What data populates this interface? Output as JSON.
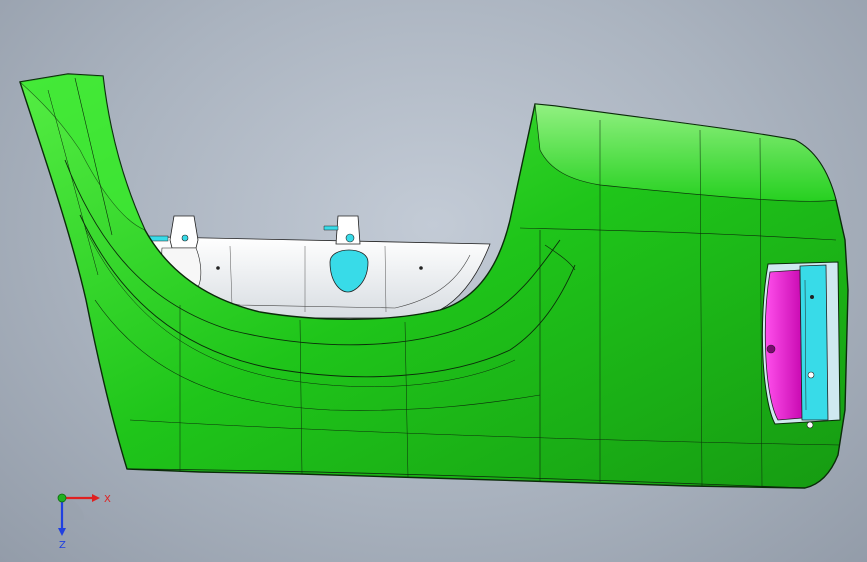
{
  "viewport": {
    "background_center": "#c3cbd6",
    "background_edge": "#939ca9"
  },
  "model": {
    "part": "bumper-end-cap",
    "body_color": "#22d11c",
    "inner_shell_color": "#f2f2f2",
    "bracket_color": "#38dbe8",
    "lamp_housing_color": "#ef0fd6",
    "edge_color": "#0b2b0a"
  },
  "triad": {
    "x_label": "X",
    "z_label": "Z",
    "x_color": "#e02020",
    "y_color": "#20b020",
    "z_color": "#2040e0"
  }
}
